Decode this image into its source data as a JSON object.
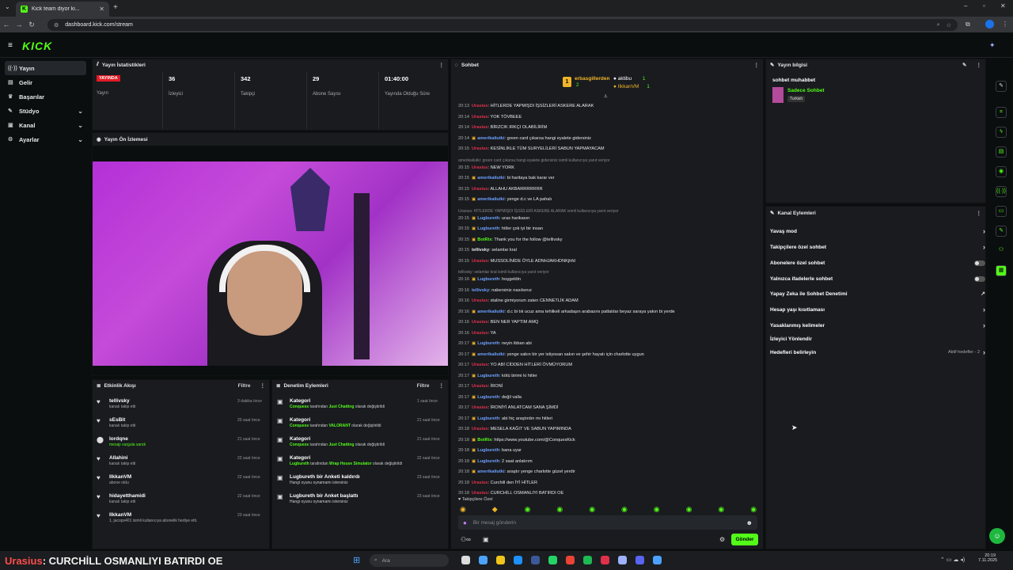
{
  "browser": {
    "tab_title": "Kick team diyor ki...",
    "url": "dashboard.kick.com/stream"
  },
  "logo": "KICK",
  "sidebar": {
    "items": [
      {
        "label": "Yayın",
        "icon": "broadcast-icon"
      },
      {
        "label": "Gelir",
        "icon": "money-icon"
      },
      {
        "label": "Başarılar",
        "icon": "trophy-icon"
      },
      {
        "label": "Stüdyo",
        "icon": "studio-icon"
      },
      {
        "label": "Kanal",
        "icon": "channel-icon"
      },
      {
        "label": "Ayarlar",
        "icon": "gear-icon"
      }
    ]
  },
  "stats": {
    "title": "Yayın İstatistikleri",
    "live_badge": "YAYINDA",
    "stream_label": "Yayın",
    "viewers": "36",
    "viewers_label": "İzleyici",
    "followers": "342",
    "followers_label": "Takipçi",
    "subs": "29",
    "subs_label": "Abone Sayısı",
    "duration": "01:40:00",
    "duration_label": "Yayında Olduğu Süre"
  },
  "preview": {
    "title": "Yayın Ön İzlemesi"
  },
  "activity": {
    "title": "Etkinlik Akışı",
    "filter": "Filtre",
    "items": [
      {
        "name": "tellivsky",
        "sub": "kanalı takip etti",
        "time": "3 dakika önce",
        "green": false
      },
      {
        "name": "sEsBit",
        "sub": "kanalı takip etti",
        "time": "20 saat önce",
        "green": false
      },
      {
        "name": "lordqne",
        "sub": "mesajı vurgula sandı",
        "time": "21 saat önce",
        "green": true
      },
      {
        "name": "Allahini",
        "sub": "kanalı takip etti",
        "time": "22 saat önce",
        "green": false
      },
      {
        "name": "IlkkanVM",
        "sub": "abone oldu",
        "time": "22 saat önce",
        "green": false
      },
      {
        "name": "hidayetthamidi",
        "sub": "kanalı takip etti",
        "time": "22 saat önce",
        "green": false
      },
      {
        "name": "IlkkanVM",
        "sub": "1, jacops401 isimli kullanıcıya abonelik hediye etti.",
        "time": "23 saat önce",
        "green": false
      }
    ]
  },
  "moderation": {
    "title": "Denetim Eylemleri",
    "filter": "Filtre",
    "items": [
      {
        "name": "Kategori",
        "by": "Conquess",
        "mid": " tarafından ",
        "val": "Just Chatting",
        "end": " olarak değiştirildi",
        "time": "1 saat önce"
      },
      {
        "name": "Kategori",
        "by": "Conquess",
        "mid": " tarafından ",
        "val": "VALORANT",
        "end": " olarak değiştirildi",
        "time": "21 saat önce"
      },
      {
        "name": "Kategori",
        "by": "Conquess",
        "mid": " tarafından ",
        "val": "Just Chatting",
        "end": " olarak değiştirildi",
        "time": "21 saat önce"
      },
      {
        "name": "Kategori",
        "by": "Lugbureth",
        "mid": " tarafından ",
        "val": "Wrap House Simulator",
        "end": " olarak değiştirildi",
        "time": "22 saat önce"
      },
      {
        "name": "Lugbureth bir Anketi kaldırdı",
        "by": "",
        "mid": "Hangi oyunu oynamamı istersiniz",
        "val": "",
        "end": "",
        "time": "23 saat önce"
      },
      {
        "name": "Lugbureth bir Anket başlattı",
        "by": "",
        "mid": "Hangi oyunu oynamamı istersiniz",
        "val": "",
        "end": "",
        "time": "23 saat önce"
      }
    ]
  },
  "chat": {
    "title": "Sohbet",
    "top_gifter": "erbasgillerden",
    "top_gifter_count": "2",
    "aktibu": "aktibu",
    "aktibu_count": "1",
    "ilkkan": "IlkkanVM",
    "ilkkan_count": "1",
    "lines": [
      {
        "t": "20:13",
        "u": "Urasius",
        "c": "#e0314b",
        "m": ": HİTLERDE YAPMIŞDI İŞSİZLERİ ASKERE ALARAK"
      },
      {
        "t": "20:14",
        "u": "Urasius",
        "c": "#e0314b",
        "m": ": YOK TÖVBEEE"
      },
      {
        "t": "20:14",
        "u": "Urasius",
        "c": "#e0314b",
        "m": ": BİRZCIK IRKÇI OLABİLİRİM"
      },
      {
        "t": "20:14",
        "u": "amerikaliutki",
        "c": "#6ea0ff",
        "m": ": green card çıkarsa hangi eyalete gidersiniz"
      },
      {
        "t": "20:15",
        "u": "Urasius",
        "c": "#e0314b",
        "m": ": KESİNLİKLE TÜM SURYELİLERİ SABUN YAPMAYACAM"
      },
      {
        "sys": "amerikaliutki: green card çıkarsa hangi eyalete gidersiniz isimli kullanıcıya yanıt veriyor"
      },
      {
        "t": "20:15",
        "u": "Urasius",
        "c": "#e0314b",
        "m": ": NEW YORK"
      },
      {
        "t": "20:15",
        "u": "amerikaliutki",
        "c": "#6ea0ff",
        "m": ": bi haritaya bak karar ver"
      },
      {
        "t": "20:15",
        "u": "Urasius",
        "c": "#e0314b",
        "m": ": ALLAHU AKBARRRRRRR"
      },
      {
        "t": "20:15",
        "u": "amerikaliutki",
        "c": "#6ea0ff",
        "m": ": yenge d.c ve LA pahalı"
      },
      {
        "sys": "Urasius: HİTLERDE YAPMIŞDI İŞSİZLERİ ASKERE ALARAK isimli kullanıcıya yanıt veriyor"
      },
      {
        "t": "20:15",
        "u": "Lugbureth",
        "c": "#6ea0ff",
        "m": ": uras harikasın"
      },
      {
        "t": "20:15",
        "u": "Lugbureth",
        "c": "#6ea0ff",
        "m": ": hitler çok iyi bir insan"
      },
      {
        "t": "20:15",
        "u": "BotRix",
        "c": "#53fc18",
        "m": ": Thank you for the follow @tellivsky"
      },
      {
        "t": "20:15",
        "u": "tellivsky",
        "c": "#e6e8ea",
        "m": ": selamlar kral"
      },
      {
        "t": "20:15",
        "u": "Urasius",
        "c": "#e0314b",
        "m": ": MUSSOLİNİDE ÖYLE ADNHJAKHDNKjhfd"
      },
      {
        "sys": "tellivsky: selamlar kral isimli kullanıcıya yanıt veriyor"
      },
      {
        "t": "20:16",
        "u": "Lugbureth",
        "c": "#6ea0ff",
        "m": ": hoşgeldin"
      },
      {
        "t": "20:16",
        "u": "tellivsky",
        "c": "#6ea0ff",
        "m": ": nabersiniz nasılsınız"
      },
      {
        "t": "20:16",
        "u": "Urasius",
        "c": "#e0314b",
        "m": ": staline girmiyorum zaten CENNETLİK ADAM"
      },
      {
        "t": "20:16",
        "u": "amerikaliutki",
        "c": "#6ea0ff",
        "m": ": d.c bi tık ucuz ama tehlikeli arkadaşın arabasını patlatılar beyaz saraya yakın bi yerde"
      },
      {
        "t": "20:16",
        "u": "Urasius",
        "c": "#e0314b",
        "m": ": BEN NER YAPTIM AMQ"
      },
      {
        "t": "20:16",
        "u": "Urasius",
        "c": "#e0314b",
        "m": ": YA"
      },
      {
        "t": "20:17",
        "u": "Lugbureth",
        "c": "#6ea0ff",
        "m": ": neyin ibban abi"
      },
      {
        "t": "20:17",
        "u": "amerikaliutki",
        "c": "#6ea0ff",
        "m": ": yenge sakın bir yer istiyosan sakın ve şehir hayatı için charlotte uygun"
      },
      {
        "t": "20:17",
        "u": "Urasius",
        "c": "#e0314b",
        "m": ": YO ABİ CİDDEN HİTLERİ ÖVMÜYORUM"
      },
      {
        "t": "20:17",
        "u": "Lugbureth",
        "c": "#6ea0ff",
        "m": ": kötü birimi ki hitler"
      },
      {
        "t": "20:17",
        "u": "Urasius",
        "c": "#e0314b",
        "m": ": İRONİ"
      },
      {
        "t": "20:17",
        "u": "Lugbureth",
        "c": "#6ea0ff",
        "m": ": değil valla"
      },
      {
        "t": "20:17",
        "u": "Urasius",
        "c": "#e0314b",
        "m": ": İRONİYİ ANLATCAM SANA ŞİMDİ"
      },
      {
        "t": "20:17",
        "u": "Lugbureth",
        "c": "#6ea0ff",
        "m": ": abi hiç araştırdın mı hitleri"
      },
      {
        "t": "20:18",
        "u": "Urasius",
        "c": "#e0314b",
        "m": ": MESELA KAĞIT VE SABUN YAPIMINDA"
      },
      {
        "t": "20:18",
        "u": "BotRix",
        "c": "#53fc18",
        "m": ": https://www.youtube.com/@ConquesKick"
      },
      {
        "t": "20:18",
        "u": "Lugbureth",
        "c": "#6ea0ff",
        "m": ": bana uyar"
      },
      {
        "t": "20:18",
        "u": "Lugbureth",
        "c": "#6ea0ff",
        "m": ": 2 saat anlatırım"
      },
      {
        "t": "20:18",
        "u": "amerikaliutki",
        "c": "#6ea0ff",
        "m": ": araştır yenge charlotte güzel yerdir"
      },
      {
        "t": "20:18",
        "u": "Urasius",
        "c": "#e0314b",
        "m": ": Curchill den İYİ HİTLER"
      },
      {
        "t": "20:18",
        "u": "Urasius",
        "c": "#e0314b",
        "m": ": CURCHİLL OSMANLIYI BATIRDI OE"
      }
    ],
    "followers_only": "Takipçilere Özel",
    "placeholder": "Bir mesaj gönderin",
    "send": "Gönder"
  },
  "stream_info": {
    "title": "Yayın bilgisi",
    "stream_title": "sohbet muhabbet",
    "category": "Sadece Sohbet",
    "language": "Turkish"
  },
  "channel_actions": {
    "title": "Kanal Eylemleri",
    "rows": [
      {
        "label": "Yavaş mod",
        "ctrl": "arrow"
      },
      {
        "label": "Takipçilere özel sohbet",
        "ctrl": "arrow"
      },
      {
        "label": "Abonelere özel sohbet",
        "ctrl": "toggle"
      },
      {
        "label": "Yalnızca ifadelerle sohbet",
        "ctrl": "toggle"
      },
      {
        "label": "Yapay Zeka ile Sohbet Denetimi",
        "ctrl": "ext"
      },
      {
        "label": "Hesap yaşı kısıtlaması",
        "ctrl": "arrow"
      },
      {
        "label": "Yasaklanmış kelimeler",
        "ctrl": "arrow"
      },
      {
        "label": "İzleyici Yönlendir",
        "ctrl": "none"
      },
      {
        "label": "Hedefleri belirleyin",
        "ctrl": "goal"
      }
    ],
    "goal_text": "Aktif hedefler - 2"
  },
  "overlay_text": {
    "user": "Urasius",
    "message": ": CURCHİLL OSMANLIYI BATIRDI OE"
  },
  "taskbar": {
    "search": "Ara",
    "time": "20:19",
    "date": "7.11.2025"
  },
  "colors": {
    "kick_green": "#53fc18",
    "live_red": "#e01b24",
    "panel": "#191b1f"
  }
}
